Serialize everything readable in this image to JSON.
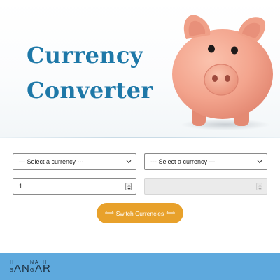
{
  "hero": {
    "title_line1": "Currency",
    "title_line2": "Converter"
  },
  "converter": {
    "from_currency": {
      "selected": "--- Select a currency ---"
    },
    "to_currency": {
      "selected": "--- Select a currency ---"
    },
    "from_amount": {
      "value": "1"
    },
    "to_amount": {
      "value": ""
    },
    "switch_label": "Switch Currencies",
    "switch_icon_left": "⟷",
    "switch_icon_right": "⟷"
  },
  "footer": {
    "logo_text": "HANNAH SANGAR"
  },
  "colors": {
    "title": "#1e78a8",
    "button": "#e8a12b",
    "footer": "#5ea9dd",
    "logo": "#1a2a38"
  },
  "icons": {
    "select_arrow": "chevron-down-icon",
    "number_spinner": "spinner-icon",
    "switch": "double-arrow-icon",
    "hero_image": "piggy-bank-image"
  }
}
